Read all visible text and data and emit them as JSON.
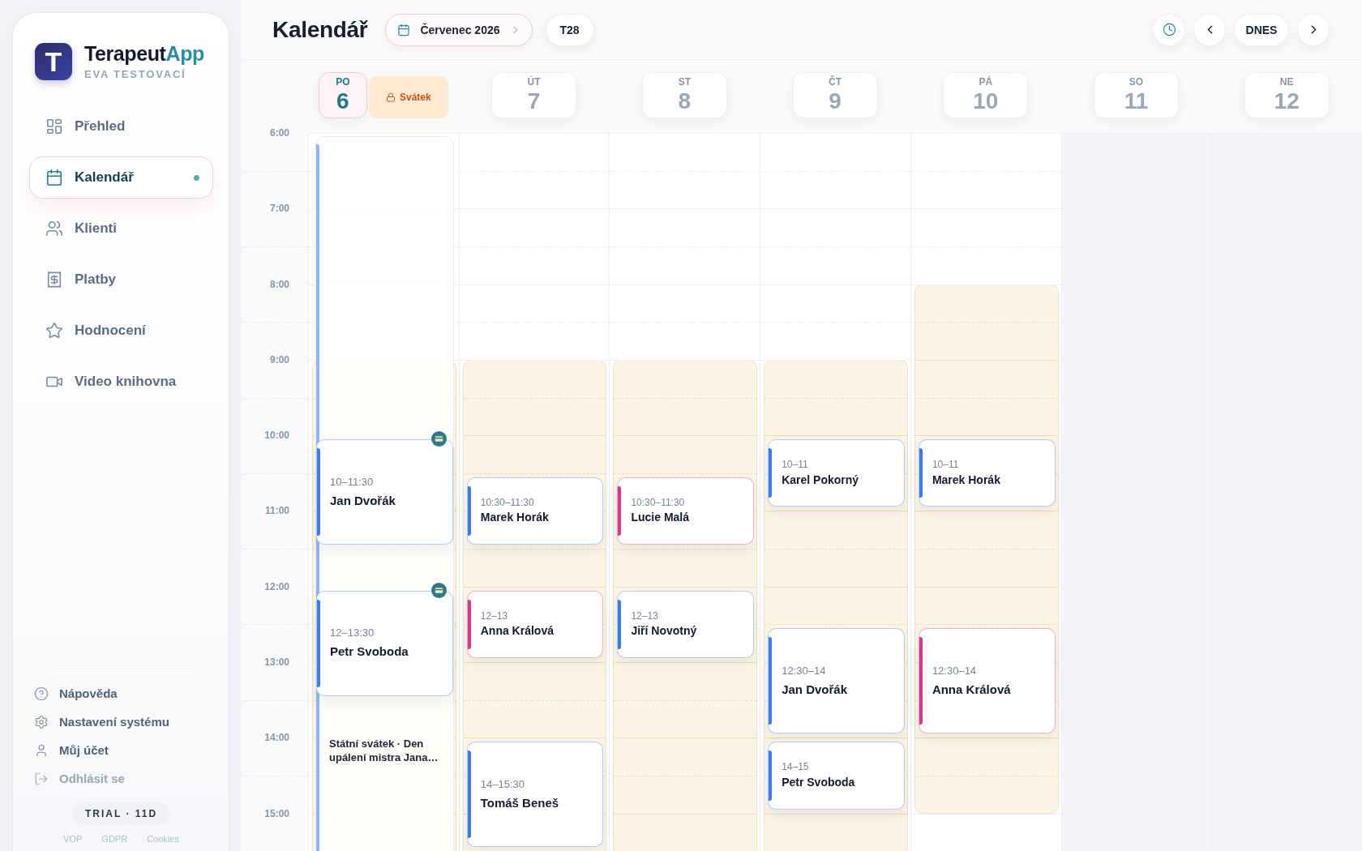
{
  "sidebar": {
    "logo_letter": "T",
    "brand": {
      "main": "Terapeut",
      "accent": "App"
    },
    "user": "EVA TESTOVACÍ",
    "nav": [
      {
        "label": "Přehled",
        "selected": false
      },
      {
        "label": "Kalendář",
        "selected": true
      },
      {
        "label": "Klienti",
        "selected": false
      },
      {
        "label": "Platby",
        "selected": false
      },
      {
        "label": "Hodnocení",
        "selected": false
      },
      {
        "label": "Video knihovna",
        "selected": false
      }
    ],
    "links": [
      {
        "label": "Nápověda",
        "muted": false
      },
      {
        "label": "Nastavení systému",
        "muted": false
      },
      {
        "label": "Můj účet",
        "muted": false
      },
      {
        "label": "Odhlásit se",
        "muted": true
      }
    ],
    "plan": "TRIAL · 11D",
    "legal": [
      "VOP",
      "GDPR",
      "Cookies"
    ]
  },
  "header": {
    "title": "Kalendář",
    "month": "Červenec 2026",
    "week": "T28",
    "today": "DNES"
  },
  "days": [
    {
      "weekday": "PO",
      "date": "6",
      "selected": true,
      "weekend": false,
      "badge": "Svátek",
      "holiday": "Státní svátek · Den upálení mistra Jana…",
      "hours": [
        {
          "working": false
        },
        {
          "working": false
        },
        {
          "working": false
        },
        {
          "working": true
        },
        {
          "working": true
        },
        {
          "working": true
        },
        {
          "working": true
        },
        {
          "working": true
        },
        {
          "working": true
        },
        {
          "working": true
        }
      ],
      "events": [
        {
          "time": "10–11:30",
          "name": "Jan Dvořák",
          "color": "#3b7cf0",
          "card_icon": true
        },
        {
          "time": "12–13:30",
          "name": "Petr Svoboda",
          "color": "#3b7cf0",
          "card_icon": true
        }
      ]
    },
    {
      "weekday": "ÚT",
      "date": "7",
      "selected": false,
      "weekend": false,
      "hours": [
        {
          "working": false
        },
        {
          "working": false
        },
        {
          "working": false
        },
        {
          "working": true
        },
        {
          "working": true
        },
        {
          "working": true
        },
        {
          "working": true
        },
        {
          "working": true
        },
        {
          "working": true
        },
        {
          "working": true
        }
      ],
      "events": [
        {
          "time": "10:30–11:30",
          "name": "Marek Horák",
          "color": "#3b7cf0",
          "card_icon": false
        },
        {
          "time": "12–13",
          "name": "Anna Králová",
          "color": "#e0338a",
          "card_icon": false
        },
        {
          "time": "14–15:30",
          "name": "Tomáš Beneš",
          "color": "#3b7cf0",
          "card_icon": false
        }
      ]
    },
    {
      "weekday": "ST",
      "date": "8",
      "selected": false,
      "weekend": false,
      "hours": [
        {
          "working": false
        },
        {
          "working": false
        },
        {
          "working": false
        },
        {
          "working": true
        },
        {
          "working": true
        },
        {
          "working": true
        },
        {
          "working": true
        },
        {
          "working": true
        },
        {
          "working": true
        },
        {
          "working": true
        }
      ],
      "events": [
        {
          "time": "10:30–11:30",
          "name": "Lucie Malá",
          "color": "#e0338a",
          "card_icon": false
        },
        {
          "time": "12–13",
          "name": "Jiří Novotný",
          "color": "#3b7cf0",
          "card_icon": false
        }
      ]
    },
    {
      "weekday": "ČT",
      "date": "9",
      "selected": false,
      "weekend": false,
      "hours": [
        {
          "working": false
        },
        {
          "working": false
        },
        {
          "working": false
        },
        {
          "working": true
        },
        {
          "working": true
        },
        {
          "working": true
        },
        {
          "working": true
        },
        {
          "working": true
        },
        {
          "working": true
        },
        {
          "working": true
        }
      ],
      "events": [
        {
          "time": "10–11",
          "name": "Karel Pokorný",
          "color": "#3b7cf0",
          "card_icon": false
        },
        {
          "time": "12:30–14",
          "name": "Jan Dvořák",
          "color": "#3b7cf0",
          "card_icon": false
        },
        {
          "time": "14–15",
          "name": "Petr Svoboda",
          "color": "#3b7cf0",
          "card_icon": false
        }
      ]
    },
    {
      "weekday": "PÁ",
      "date": "10",
      "selected": false,
      "weekend": false,
      "hours": [
        {
          "working": false
        },
        {
          "working": false
        },
        {
          "working": true
        },
        {
          "working": true
        },
        {
          "working": true
        },
        {
          "working": true
        },
        {
          "working": true
        },
        {
          "working": true
        },
        {
          "working": true
        },
        {
          "working": false
        }
      ],
      "events": [
        {
          "time": "10–11",
          "name": "Marek Horák",
          "color": "#3b7cf0",
          "card_icon": false
        },
        {
          "time": "12:30–14",
          "name": "Anna Králová",
          "color": "#e0338a",
          "card_icon": false
        }
      ]
    },
    {
      "weekday": "SO",
      "date": "11",
      "selected": false,
      "weekend": true,
      "hours": [
        {
          "working": false
        },
        {
          "working": false
        },
        {
          "working": false
        },
        {
          "working": false
        },
        {
          "working": false
        },
        {
          "working": false
        },
        {
          "working": false
        },
        {
          "working": false
        },
        {
          "working": false
        },
        {
          "working": false
        }
      ]
    },
    {
      "weekday": "NE",
      "date": "12",
      "selected": false,
      "weekend": true,
      "hours": [
        {
          "working": false
        },
        {
          "working": false
        },
        {
          "working": false
        },
        {
          "working": false
        },
        {
          "working": false
        },
        {
          "working": false
        },
        {
          "working": false
        },
        {
          "working": false
        },
        {
          "working": false
        },
        {
          "working": false
        }
      ]
    }
  ],
  "times": [
    "6:00",
    "7:00",
    "8:00",
    "9:00",
    "10:00",
    "11:00",
    "12:00",
    "13:00",
    "14:00",
    "15:00"
  ]
}
